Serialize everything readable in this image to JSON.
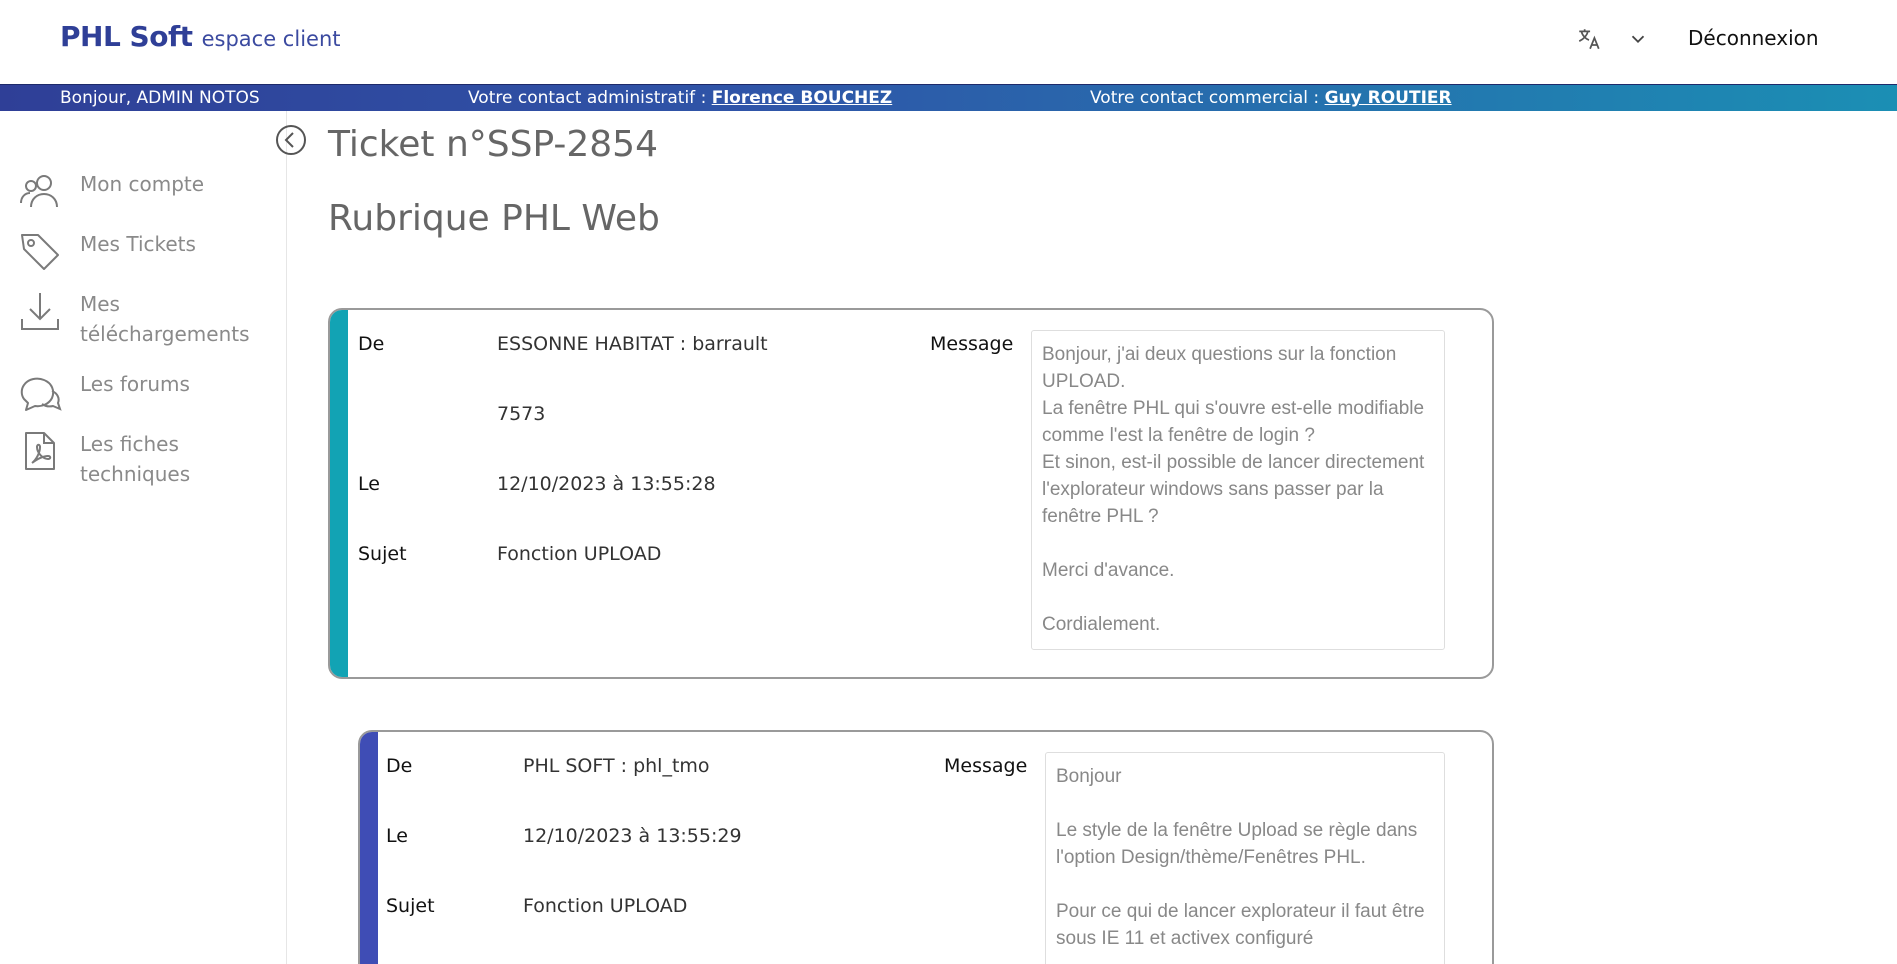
{
  "header": {
    "brand_main": "PHL Soft",
    "brand_sub": "espace client",
    "logout_label": "Déconnexion"
  },
  "infobar": {
    "greeting": "Bonjour, ADMIN NOTOS",
    "admin_prefix": "Votre contact administratif : ",
    "admin_name": "Florence BOUCHEZ",
    "commercial_prefix": "Votre contact commercial : ",
    "commercial_name": "Guy ROUTIER"
  },
  "sidebar": {
    "items": [
      {
        "label": "Mon compte",
        "icon": "users-icon"
      },
      {
        "label": "Mes Tickets",
        "icon": "tag-icon"
      },
      {
        "label": "Mes téléchargements",
        "icon": "download-icon"
      },
      {
        "label": "Les forums",
        "icon": "chat-icon"
      },
      {
        "label": "Les fiches techniques",
        "icon": "pdf-file-icon"
      }
    ]
  },
  "main": {
    "ticket_title": "Ticket n°SSP-2854",
    "rubrique": "Rubrique PHL Web"
  },
  "messages": [
    {
      "de_label": "De",
      "de_value": "ESSONNE HABITAT : barrault",
      "extra_value": "7573",
      "le_label": "Le",
      "le_value": "12/10/2023 à 13:55:28",
      "sujet_label": "Sujet",
      "sujet_value": "Fonction UPLOAD",
      "message_label": "Message",
      "message_text": "Bonjour, j'ai deux questions sur la fonction UPLOAD.\nLa fenêtre PHL qui s'ouvre est-elle modifiable comme l'est la fenêtre de login ?\nEt sinon, est-il possible de lancer directement l'explorateur windows sans passer par la fenêtre PHL ?\n\nMerci d'avance.\n\nCordialement.",
      "stripe_color": "#12a3b4"
    },
    {
      "de_label": "De",
      "de_value": "PHL SOFT : phl_tmo",
      "le_label": "Le",
      "le_value": "12/10/2023 à 13:55:29",
      "sujet_label": "Sujet",
      "sujet_value": "Fonction UPLOAD",
      "message_label": "Message",
      "message_text": "Bonjour\n\nLe style de la fenêtre Upload se règle dans l'option Design/thème/Fenêtres PHL.\n\nPour ce qui de lancer explorateur  il faut être sous IE 11 et activex configuré",
      "stripe_color": "#3f4db5"
    }
  ],
  "colors": {
    "brand": "#2f3f97",
    "bar_start": "#2f3f97",
    "bar_end": "#1b8fb4"
  }
}
